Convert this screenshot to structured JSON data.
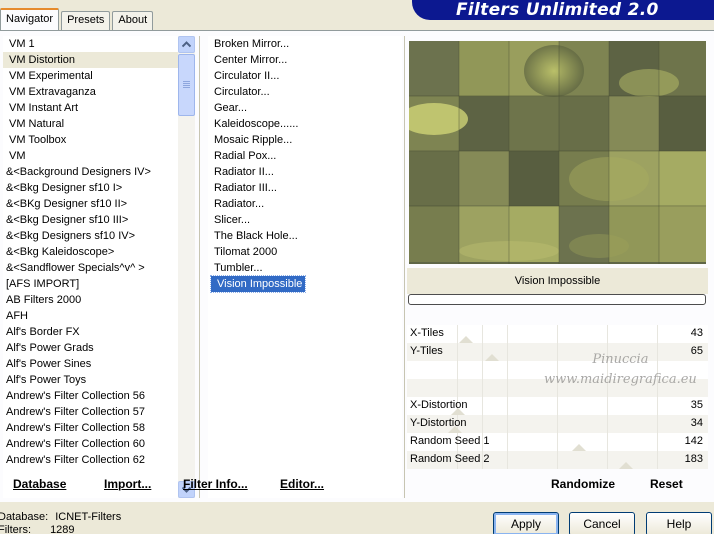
{
  "tabs": [
    "Navigator",
    "Presets",
    "About"
  ],
  "banner": {
    "title": "Filters Unlimited 2.0"
  },
  "categories": [
    "VM 1",
    "VM Distortion",
    "VM Experimental",
    "VM Extravaganza",
    "VM Instant Art",
    "VM Natural",
    "VM Toolbox",
    "VM",
    "&<Background Designers IV>",
    "&<Bkg Designer sf10 I>",
    "&<BKg Designer sf10 II>",
    "&<Bkg Designer sf10 III>",
    "&<Bkg Designers sf10 IV>",
    "&<Bkg Kaleidoscope>",
    "&<Sandflower Specials^v^ >",
    "[AFS IMPORT]",
    "AB Filters 2000",
    "AFH",
    "Alf's Border FX",
    "Alf's Power Grads",
    "Alf's Power Sines",
    "Alf's Power Toys",
    "Andrew's Filter Collection 56",
    "Andrew's Filter Collection 57",
    "Andrew's Filter Collection 58",
    "Andrew's Filter Collection 60",
    "Andrew's Filter Collection 62"
  ],
  "selected_category": "VM Distortion",
  "filters": [
    "Broken Mirror...",
    "Center Mirror...",
    "Circulator II...",
    "Circulator...",
    "Gear...",
    "Kaleidoscope......",
    "Mosaic Ripple...",
    "Radial Pox...",
    "Radiator II...",
    "Radiator III...",
    "Radiator...",
    "Slicer...",
    "The Black Hole...",
    "Tilomat 2000",
    "Tumbler...",
    "Vision Impossible"
  ],
  "selected_filter": "Vision Impossible",
  "filter_name": "Vision Impossible",
  "params": [
    {
      "label": "X-Tiles",
      "value": "43",
      "level": 0.17
    },
    {
      "label": "Y-Tiles",
      "value": "65",
      "level": 0.26
    },
    {
      "label": "",
      "value": "",
      "level": null
    },
    {
      "label": "",
      "value": "",
      "level": null
    },
    {
      "label": "X-Distortion",
      "value": "35",
      "level": 0.14
    },
    {
      "label": "Y-Distortion",
      "value": "34",
      "level": 0.13
    },
    {
      "label": "Random Seed 1",
      "value": "142",
      "level": 0.56
    },
    {
      "label": "Random Seed 2",
      "value": "183",
      "level": 0.72
    }
  ],
  "watermark": {
    "line1": "Pinuccia",
    "line2": "www.maidiregrafica.eu"
  },
  "toolbar": {
    "database": "Database",
    "import": "Import...",
    "filter_info": "Filter Info...",
    "editor": "Editor...",
    "randomize": "Randomize",
    "reset": "Reset"
  },
  "status": {
    "database_label": "Database:",
    "database_value": "ICNET-Filters",
    "filters_label": "Filters:",
    "filters_value": "1289"
  },
  "buttons": {
    "apply": "Apply",
    "cancel": "Cancel",
    "help": "Help"
  },
  "colors": {
    "banner": "#0c1890",
    "selection": "#316ac5",
    "tab_highlight": "#e68b2c"
  }
}
